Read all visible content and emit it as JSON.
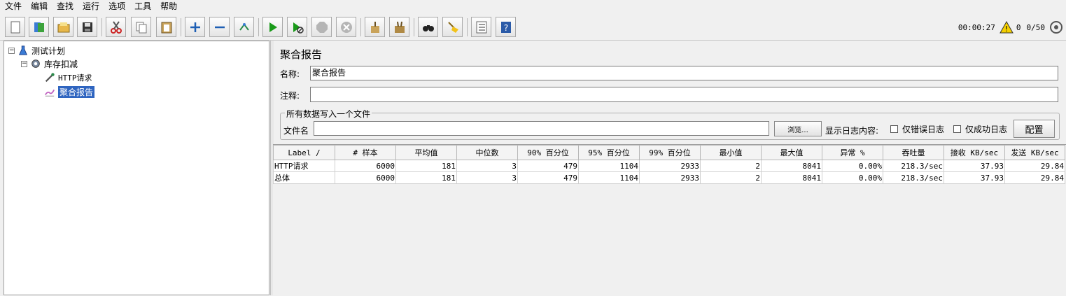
{
  "menu": [
    "文件",
    "编辑",
    "查找",
    "运行",
    "选项",
    "工具",
    "帮助"
  ],
  "toolbar_icons": [
    "new-icon",
    "templates-icon",
    "open-icon",
    "save-icon",
    "cut-icon",
    "copy-icon",
    "paste-icon",
    "expand-icon",
    "collapse-icon",
    "toggle-icon",
    "start-icon",
    "start-no-pause-icon",
    "stop-icon",
    "shutdown-icon",
    "clear-icon",
    "clear-all-icon",
    "search-icon",
    "reset-search-icon",
    "function-helper-icon",
    "help-icon"
  ],
  "status": {
    "elapsed": "00:00:27",
    "warnings": "0",
    "threads": "0/50"
  },
  "tree": {
    "root": "测试计划",
    "thread_group": "库存扣减",
    "sampler": "HTTP请求",
    "listener": "聚合报告"
  },
  "panel": {
    "title": "聚合报告",
    "name_label": "名称:",
    "name_value": "聚合报告",
    "comment_label": "注释:",
    "comment_value": "",
    "file_group_title": "所有数据写入一个文件",
    "file_label": "文件名",
    "file_value": "",
    "browse_label": "浏览...",
    "log_label": "显示日志内容:",
    "errors_only_label": "仅错误日志",
    "success_only_label": "仅成功日志",
    "configure_label": "配置"
  },
  "table": {
    "columns": [
      "Label ∕",
      "# 样本",
      "平均值",
      "中位数",
      "90% 百分位",
      "95% 百分位",
      "99% 百分位",
      "最小值",
      "最大值",
      "异常 %",
      "吞吐量",
      "接收 KB/sec",
      "发送 KB/sec"
    ],
    "rows": [
      [
        "HTTP请求",
        "6000",
        "181",
        "3",
        "479",
        "1104",
        "2933",
        "2",
        "8041",
        "0.00%",
        "218.3/sec",
        "37.93",
        "29.84"
      ],
      [
        "总体",
        "6000",
        "181",
        "3",
        "479",
        "1104",
        "2933",
        "2",
        "8041",
        "0.00%",
        "218.3/sec",
        "37.93",
        "29.84"
      ]
    ]
  },
  "colors": {
    "selection": "#2f65c0",
    "start_green": "#1a9a1a"
  }
}
